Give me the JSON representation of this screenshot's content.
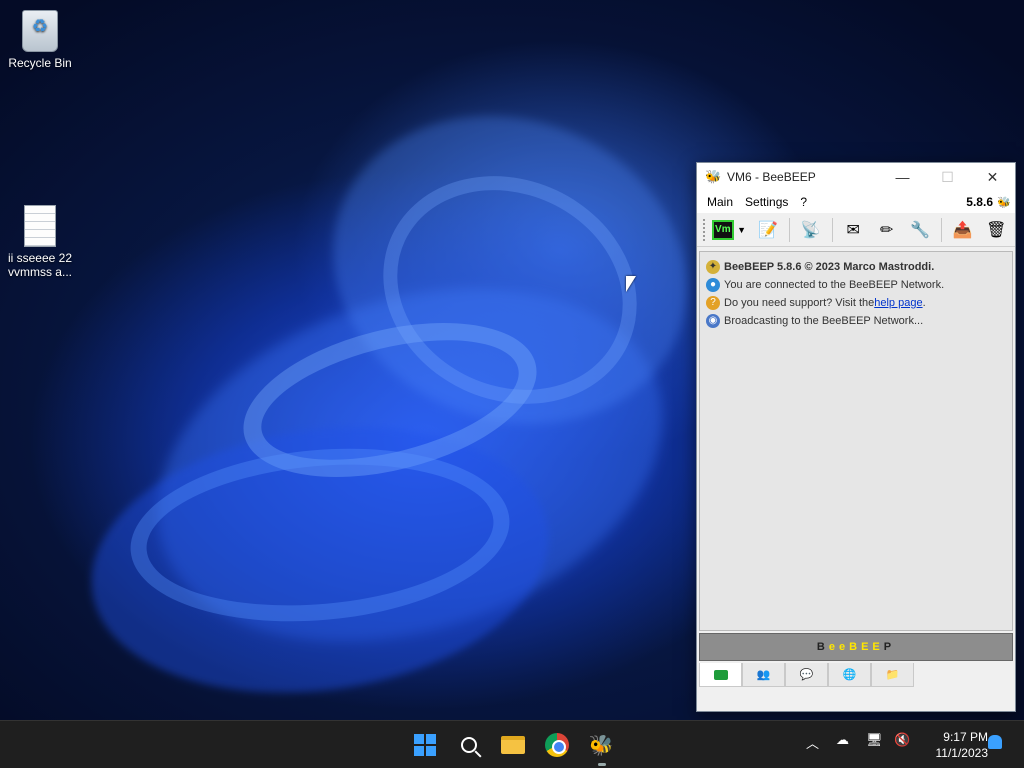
{
  "desktop": {
    "icons": [
      {
        "label": "Recycle Bin",
        "icon": "recycle-bin-icon"
      },
      {
        "label": "ii  sseeee  22 vvmmss  a...",
        "icon": "text-document-icon"
      }
    ]
  },
  "window": {
    "title": "VM6 - BeeBEEP",
    "controls": {
      "minimize": "—",
      "maximize": "☐",
      "close": "✕"
    },
    "menu": [
      "Main",
      "Settings",
      "?"
    ],
    "version": "5.8.6",
    "toolbar": {
      "vm_label": "Vm",
      "icons": [
        "edit-profile-icon",
        "network-icon",
        "message-icon",
        "write-icon",
        "tools-icon",
        "upload-icon",
        "trash-icon"
      ]
    },
    "chat_lines": {
      "line1": "BeeBEEP 5.8.6 © 2023 Marco Mastroddi.",
      "line2": "You are connected to the BeeBEEP Network.",
      "line3_prefix": "Do you need support? Visit the ",
      "line3_link": "help page",
      "line3_suffix": ".",
      "line4": "Broadcasting to the BeeBEEP Network..."
    },
    "brand_letters": [
      "B",
      "e",
      "e",
      "B",
      "E",
      "E",
      "P"
    ],
    "tabs": [
      "chat-tab-icon",
      "users-tab-icon",
      "groups-tab-icon",
      "network-tab-icon",
      "files-tab-icon"
    ]
  },
  "taskbar": {
    "apps": [
      "start-icon",
      "search-icon",
      "file-explorer-icon",
      "chrome-icon",
      "beebeep-icon"
    ],
    "tray_icons": [
      "chevron-up-icon",
      "onedrive-icon",
      "network-icon",
      "volume-muted-icon"
    ],
    "time": "9:17 PM",
    "date": "11/1/2023"
  },
  "colors": {
    "accent": "#3aa0ff",
    "brand_yellow": "#ffe600",
    "link": "#0033cc"
  }
}
